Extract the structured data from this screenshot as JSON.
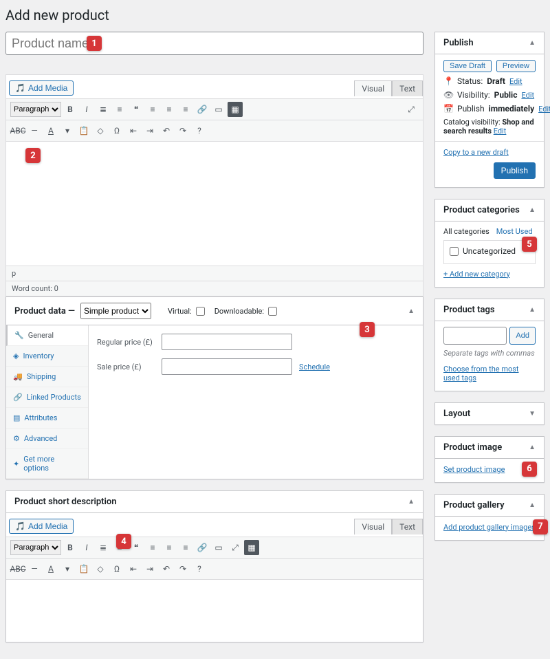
{
  "page": {
    "title": "Add new product"
  },
  "title_field": {
    "placeholder": "Product name"
  },
  "editor": {
    "add_media": "Add Media",
    "tab_visual": "Visual",
    "tab_text": "Text",
    "format_select": "Paragraph",
    "status_path": "p",
    "word_count_label": "Word count: 0"
  },
  "product_data": {
    "label": "Product data",
    "type_selected": "Simple product",
    "virtual_label": "Virtual:",
    "downloadable_label": "Downloadable:",
    "tabs": {
      "general": "General",
      "inventory": "Inventory",
      "shipping": "Shipping",
      "linked": "Linked Products",
      "attributes": "Attributes",
      "advanced": "Advanced",
      "more": "Get more options"
    },
    "regular_price_label": "Regular price (£)",
    "sale_price_label": "Sale price (£)",
    "schedule_link": "Schedule"
  },
  "short_desc": {
    "heading": "Product short description"
  },
  "publish": {
    "heading": "Publish",
    "save_draft": "Save Draft",
    "preview": "Preview",
    "status_label": "Status:",
    "status_value": "Draft",
    "visibility_label": "Visibility:",
    "visibility_value": "Public",
    "publish_label": "Publish",
    "publish_value": "immediately",
    "catalog_label": "Catalog visibility:",
    "catalog_value": "Shop and search results",
    "edit": "Edit",
    "copy_link": "Copy to a new draft",
    "publish_btn": "Publish"
  },
  "categories": {
    "heading": "Product categories",
    "tab_all": "All categories",
    "tab_most": "Most Used",
    "uncat": "Uncategorized",
    "add_new": "+ Add new category"
  },
  "tags": {
    "heading": "Product tags",
    "add_btn": "Add",
    "hint": "Separate tags with commas",
    "choose_link": "Choose from the most used tags"
  },
  "layout_box": {
    "heading": "Layout"
  },
  "image_box": {
    "heading": "Product image",
    "link": "Set product image"
  },
  "gallery_box": {
    "heading": "Product gallery",
    "link": "Add product gallery images"
  },
  "badges": {
    "b1": "1",
    "b2": "2",
    "b3": "3",
    "b4": "4",
    "b5": "5",
    "b6": "6",
    "b7": "7"
  }
}
